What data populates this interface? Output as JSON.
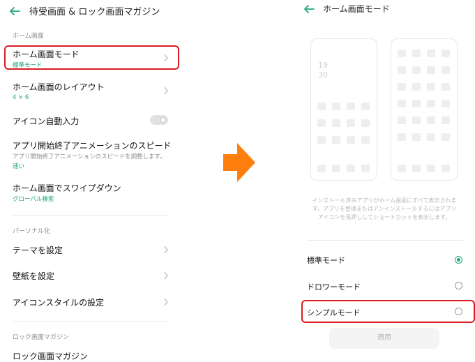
{
  "left": {
    "title": "待受画面 & ロック画面マガジン",
    "section_home": "ホーム画面",
    "home_mode": {
      "label": "ホーム画面モード",
      "value": "標準モード"
    },
    "layout": {
      "label": "ホーム画面のレイアウト",
      "value": "4 × 6"
    },
    "auto_icon": {
      "label": "アイコン自動入力"
    },
    "animation": {
      "label": "アプリ開始終了アニメーションのスピード",
      "desc": "アプリ開始終了アニメーションのスピードを調整します。",
      "value": "速い"
    },
    "swipe": {
      "label": "ホーム画面でスワイプダウン",
      "value": "グローバル検索"
    },
    "section_personal": "パーソナル化",
    "theme": "テーマを設定",
    "wallpaper": "壁紙を設定",
    "icon_style": "アイコンスタイルの設定",
    "section_lock": "ロック画面マガジン",
    "lock_magazine": "ロック画面マガジン"
  },
  "right": {
    "title": "ホーム画面モード",
    "clock_hour": "19",
    "clock_min": "30",
    "info_line1": "インストール済みアプリがホーム画面にすべて表示されま",
    "info_line2": "す。アプリを管理またはアンインストールするにはアプリ",
    "info_line3": "アイコンを長押ししてショートカットを表示します。",
    "options": [
      {
        "label": "標準モード",
        "selected": true
      },
      {
        "label": "ドロワーモード",
        "selected": false
      },
      {
        "label": "シンプルモード",
        "selected": false
      }
    ],
    "apply": "適用"
  },
  "colors": {
    "accent": "#1fa67a",
    "highlight": "#d81c22",
    "arrow": "#ff7f0e"
  },
  "icons": [
    "back-arrow-icon",
    "chevron-right-icon",
    "toggle-switch",
    "right-arrow-icon",
    "radio-button"
  ]
}
